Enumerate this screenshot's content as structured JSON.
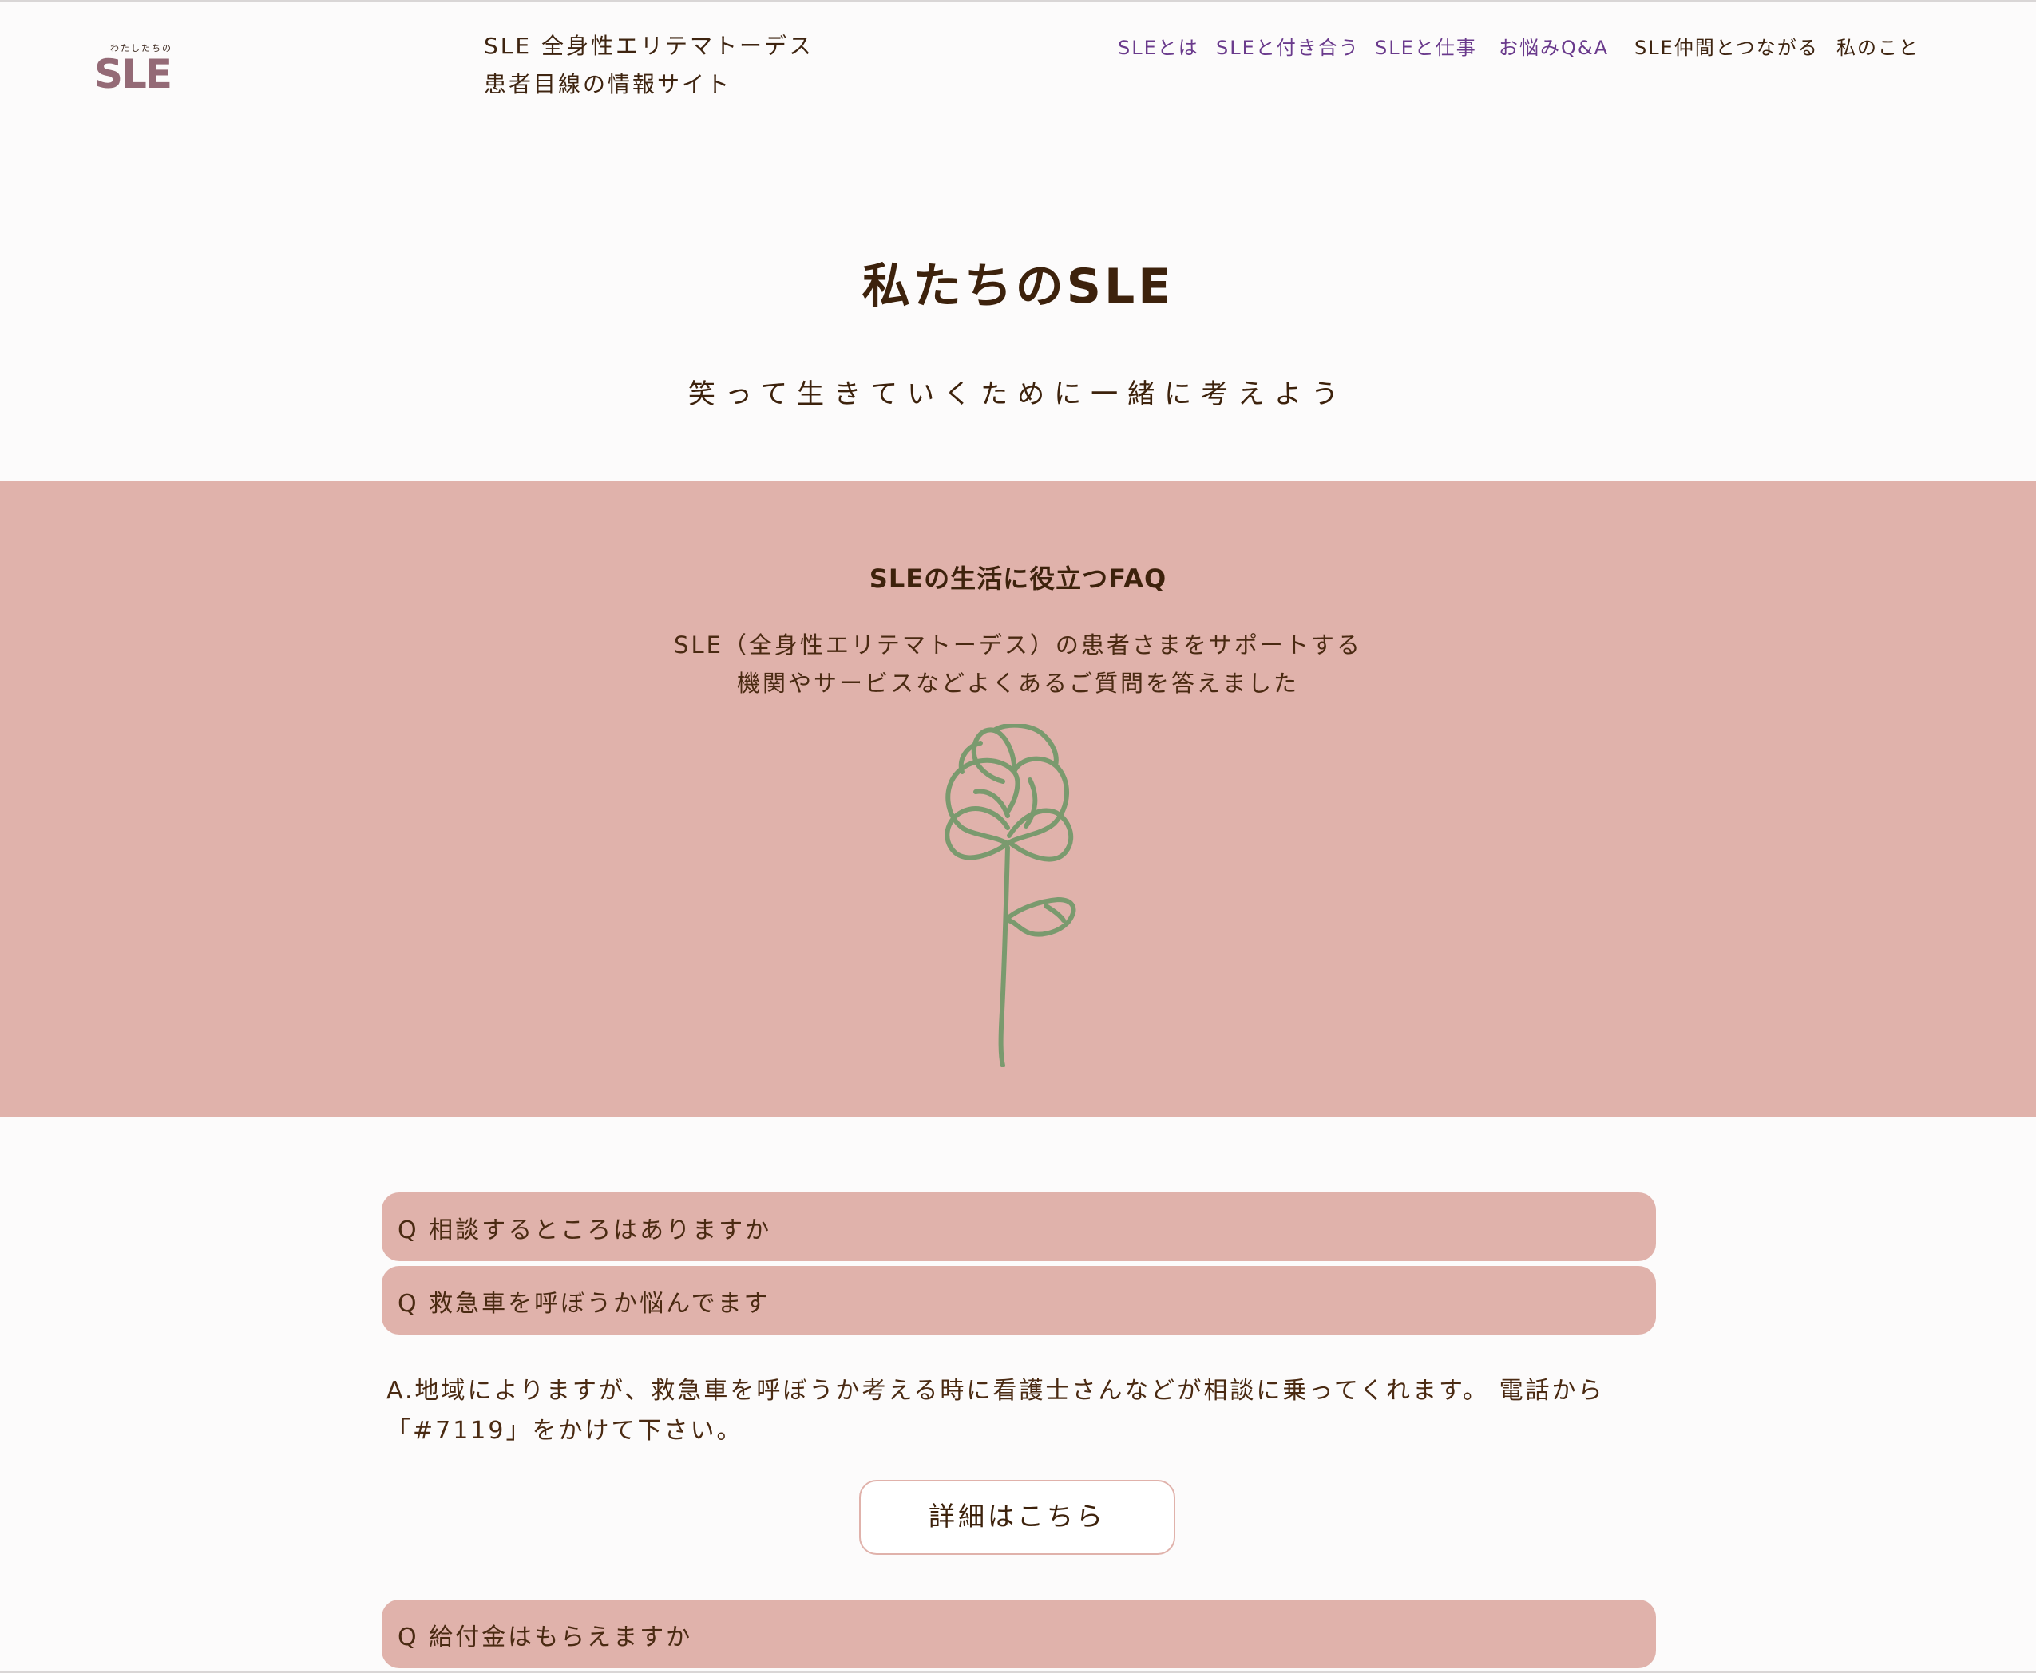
{
  "header": {
    "logo": {
      "small_text": "わたしたちの",
      "main_text": "SLE"
    },
    "site_title": {
      "line1": "SLE 全身性エリテマトーデス",
      "line2": "患者目線の情報サイト"
    }
  },
  "nav": {
    "items": [
      {
        "label": "SLEとは",
        "color": "#6a3a8c"
      },
      {
        "label": "SLEと付き合う",
        "color": "#6a3a8c"
      },
      {
        "label": "SLEと仕事",
        "color": "#6a3a8c"
      },
      {
        "label": "お悩みQ&A",
        "color": "#6a3a8c"
      },
      {
        "label": "SLE仲間とつながる",
        "color": "#3e2410"
      },
      {
        "label": "私のこと",
        "color": "#3e2410"
      }
    ]
  },
  "hero": {
    "title": "私たちのSLE",
    "subtitle": "笑って生きていくために一緒に考えよう"
  },
  "faq_intro": {
    "title": "SLEの生活に役立つFAQ",
    "desc_line1": "SLE（全身性エリテマトーデス）の患者さまをサポートする",
    "desc_line2": "機関やサービスなどよくあるご質問を答えました",
    "image_icon": "flower-line-drawing"
  },
  "faq": {
    "q1": "Q 相談するところはありますか",
    "q2": "Q 救急車を呼ぼうか悩んでます",
    "answer_line1": "A.地域によりますが、救急車を呼ぼうか考える時に看護士さんなどが相談に乗ってくれます。 電話から",
    "answer_line2": "「#7119」をかけて下さい。",
    "detail_button": "詳細はこちら",
    "q3": "Q 給付金はもらえますか"
  },
  "colors": {
    "accent_pink": "#e0b2ab",
    "text_brown": "#3d220c",
    "nav_purple": "#6a3a8c",
    "logo_mauve": "#946a76",
    "flower_green": "#7a9a6e"
  }
}
